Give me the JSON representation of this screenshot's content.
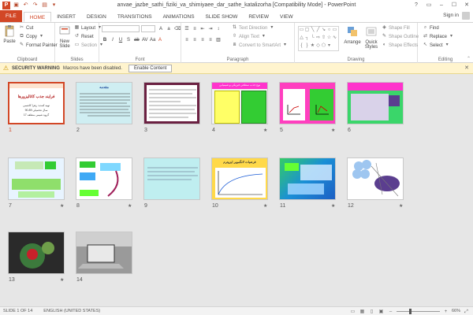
{
  "window": {
    "title": "anvae_jazbe_sathi_fiziki_va_shimiyaee_dar_sathe_katalizorha [Compatibility Mode] - PowerPoint",
    "controls": [
      "?",
      "▭",
      "–",
      "☐",
      "✕"
    ]
  },
  "tabs": {
    "file": "FILE",
    "items": [
      "HOME",
      "INSERT",
      "DESIGN",
      "TRANSITIONS",
      "ANIMATIONS",
      "SLIDE SHOW",
      "REVIEW",
      "VIEW"
    ],
    "active": "HOME",
    "sign_in": "Sign in"
  },
  "ribbon": {
    "clipboard": {
      "label": "Clipboard",
      "paste": "Paste",
      "cut": "Cut",
      "copy": "Copy",
      "format_painter": "Format Painter"
    },
    "slides": {
      "label": "Slides",
      "new_slide": "New",
      "new_slide2": "Slide",
      "layout": "Layout",
      "reset": "Reset",
      "section": "Section"
    },
    "font": {
      "label": "Font",
      "size_value": "",
      "font_value": ""
    },
    "paragraph": {
      "label": "Paragraph",
      "text_direction": "Text Direction",
      "align_text": "Align Text",
      "convert_smartart": "Convert to SmartArt"
    },
    "drawing": {
      "label": "Drawing",
      "arrange": "Arrange",
      "quick_styles": "Quick",
      "quick_styles2": "Styles",
      "shape_fill": "Shape Fill",
      "shape_outline": "Shape Outline",
      "shape_effects": "Shape Effects"
    },
    "editing": {
      "label": "Editing",
      "find": "Find",
      "replace": "Replace",
      "select": "Select"
    }
  },
  "security_bar": {
    "title": "SECURITY WARNING",
    "message": "Macros have been disabled.",
    "button": "Enable Content"
  },
  "slides": [
    {
      "num": "1",
      "selected": true,
      "star": false
    },
    {
      "num": "2",
      "selected": false,
      "star": false
    },
    {
      "num": "3",
      "selected": false,
      "star": false
    },
    {
      "num": "4",
      "selected": false,
      "star": true
    },
    {
      "num": "5",
      "selected": false,
      "star": true
    },
    {
      "num": "6",
      "selected": false,
      "star": false
    },
    {
      "num": "7",
      "selected": false,
      "star": true
    },
    {
      "num": "8",
      "selected": false,
      "star": true
    },
    {
      "num": "9",
      "selected": false,
      "star": false
    },
    {
      "num": "10",
      "selected": false,
      "star": true
    },
    {
      "num": "11",
      "selected": false,
      "star": true
    },
    {
      "num": "12",
      "selected": false,
      "star": true
    },
    {
      "num": "13",
      "selected": false,
      "star": true
    },
    {
      "num": "14",
      "selected": false,
      "star": false
    }
  ],
  "slide_text": {
    "s1_title": "فرایند جذب کاتالیزورها",
    "s1_sub1": "تهیه کننده: زهرا کاشمی",
    "s1_sub2": "سال تحصیلی 89-90",
    "s1_sub3": "گروه شیمی منطقه 17",
    "s2_title": "مقدمه",
    "s4_title": "نوع جذب سطحی فیزیکی و شیمیایی",
    "s10_title": "فرضیات لانگمویر ایزوترم"
  },
  "statusbar": {
    "slide_count": "SLIDE 1 OF 14",
    "language": "ENGLISH (UNITED STATES)",
    "zoom": "66%",
    "zoom_level": 0.66
  },
  "colors": {
    "accent": "#d24726",
    "security_bg": "#fff4ce"
  }
}
